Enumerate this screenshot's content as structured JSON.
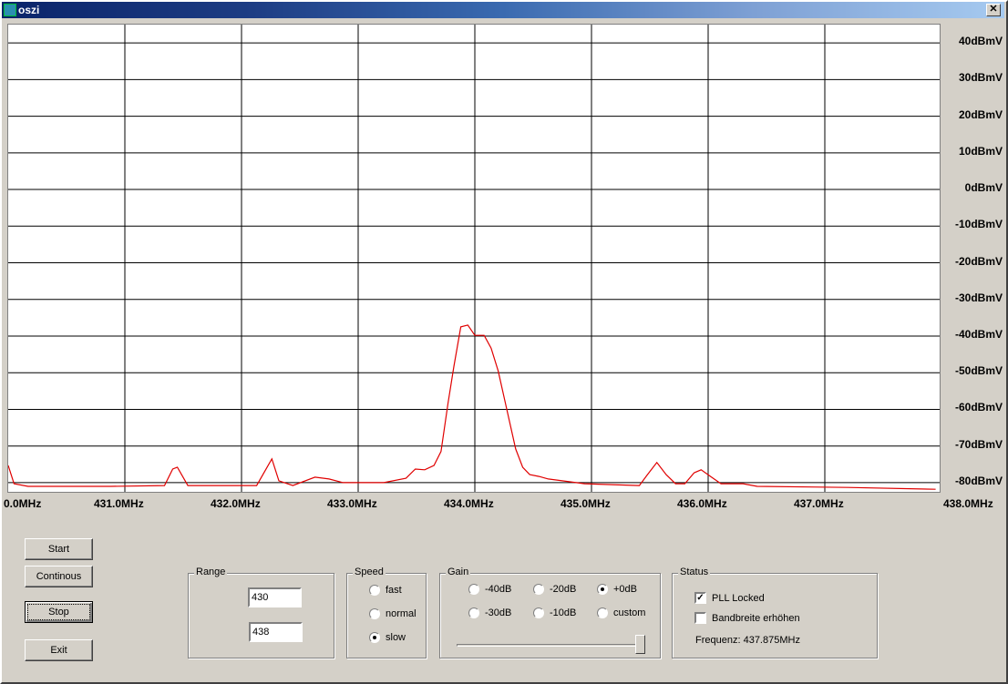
{
  "window": {
    "title": "oszi",
    "close_glyph": "✕"
  },
  "chart_data": {
    "type": "line",
    "xlim": [
      430,
      438
    ],
    "ylim": [
      -83,
      45
    ],
    "grid": true,
    "x_ticks": [
      430,
      431,
      432,
      433,
      434,
      435,
      436,
      437,
      438
    ],
    "x_tick_labels": [
      "0.0MHz",
      "431.0MHz",
      "432.0MHz",
      "433.0MHz",
      "434.0MHz",
      "435.0MHz",
      "436.0MHz",
      "437.0MHz",
      "438.0MHz"
    ],
    "y_ticks": [
      40,
      30,
      20,
      10,
      0,
      -10,
      -20,
      -30,
      -40,
      -50,
      -60,
      -70,
      -80
    ],
    "y_tick_labels": [
      "40dBmV",
      "30dBmV",
      "20dBmV",
      "10dBmV",
      "0dBmV",
      "-10dBmV",
      "-20dBmV",
      "-30dBmV",
      "-40dBmV",
      "-50dBmV",
      "-60dBmV",
      "-70dBmV",
      "-80dBmV"
    ],
    "series": [
      {
        "color": "#e00000",
        "points": [
          [
            430.0,
            -75.3
          ],
          [
            430.05,
            -80.3
          ],
          [
            430.17,
            -81
          ],
          [
            430.88,
            -81
          ],
          [
            431.34,
            -80.8
          ],
          [
            431.41,
            -76.3
          ],
          [
            431.45,
            -75.8
          ],
          [
            431.54,
            -80.8
          ],
          [
            432.13,
            -80.8
          ],
          [
            432.26,
            -73.5
          ],
          [
            432.32,
            -79.5
          ],
          [
            432.44,
            -80.8
          ],
          [
            432.63,
            -78.5
          ],
          [
            432.75,
            -79
          ],
          [
            432.87,
            -80
          ],
          [
            433.22,
            -80
          ],
          [
            433.41,
            -78.8
          ],
          [
            433.49,
            -76.3
          ],
          [
            433.57,
            -76.5
          ],
          [
            433.65,
            -75.3
          ],
          [
            433.71,
            -71.5
          ],
          [
            433.77,
            -58.3
          ],
          [
            433.82,
            -48.3
          ],
          [
            433.88,
            -37.5
          ],
          [
            433.94,
            -37
          ],
          [
            434.0,
            -39.8
          ],
          [
            434.08,
            -39.8
          ],
          [
            434.14,
            -43.3
          ],
          [
            434.2,
            -49.5
          ],
          [
            434.27,
            -59.5
          ],
          [
            434.35,
            -70.8
          ],
          [
            434.41,
            -75.8
          ],
          [
            434.47,
            -77.8
          ],
          [
            434.55,
            -78.3
          ],
          [
            434.63,
            -79
          ],
          [
            434.94,
            -80.3
          ],
          [
            435.41,
            -80.8
          ],
          [
            435.48,
            -77.8
          ],
          [
            435.56,
            -74.5
          ],
          [
            435.64,
            -77.8
          ],
          [
            435.72,
            -80.3
          ],
          [
            435.8,
            -80.3
          ],
          [
            435.88,
            -77.3
          ],
          [
            435.94,
            -76.5
          ],
          [
            436.02,
            -78.3
          ],
          [
            436.11,
            -80.3
          ],
          [
            436.3,
            -80.3
          ],
          [
            436.42,
            -81
          ],
          [
            437.2,
            -81.3
          ],
          [
            437.95,
            -81.8
          ]
        ]
      }
    ]
  },
  "controls": {
    "start": "Start",
    "continous": "Continous",
    "stop": "Stop",
    "exit": "Exit"
  },
  "range": {
    "label": "Range",
    "from": "430",
    "to": "438"
  },
  "speed": {
    "label": "Speed",
    "options": [
      "fast",
      "normal",
      "slow"
    ],
    "selected": "slow"
  },
  "gain": {
    "label": "Gain",
    "options": [
      "-40dB",
      "-20dB",
      "+0dB",
      "-30dB",
      "-10dB",
      "custom"
    ],
    "selected": "+0dB",
    "slider_fraction": 1.0
  },
  "status": {
    "label": "Status",
    "pll_locked": "PLL Locked",
    "pll_checked": true,
    "bandwidth": "Bandbreite erhöhen",
    "bandwidth_checked": false,
    "frequency": "Frequenz: 437.875MHz"
  }
}
